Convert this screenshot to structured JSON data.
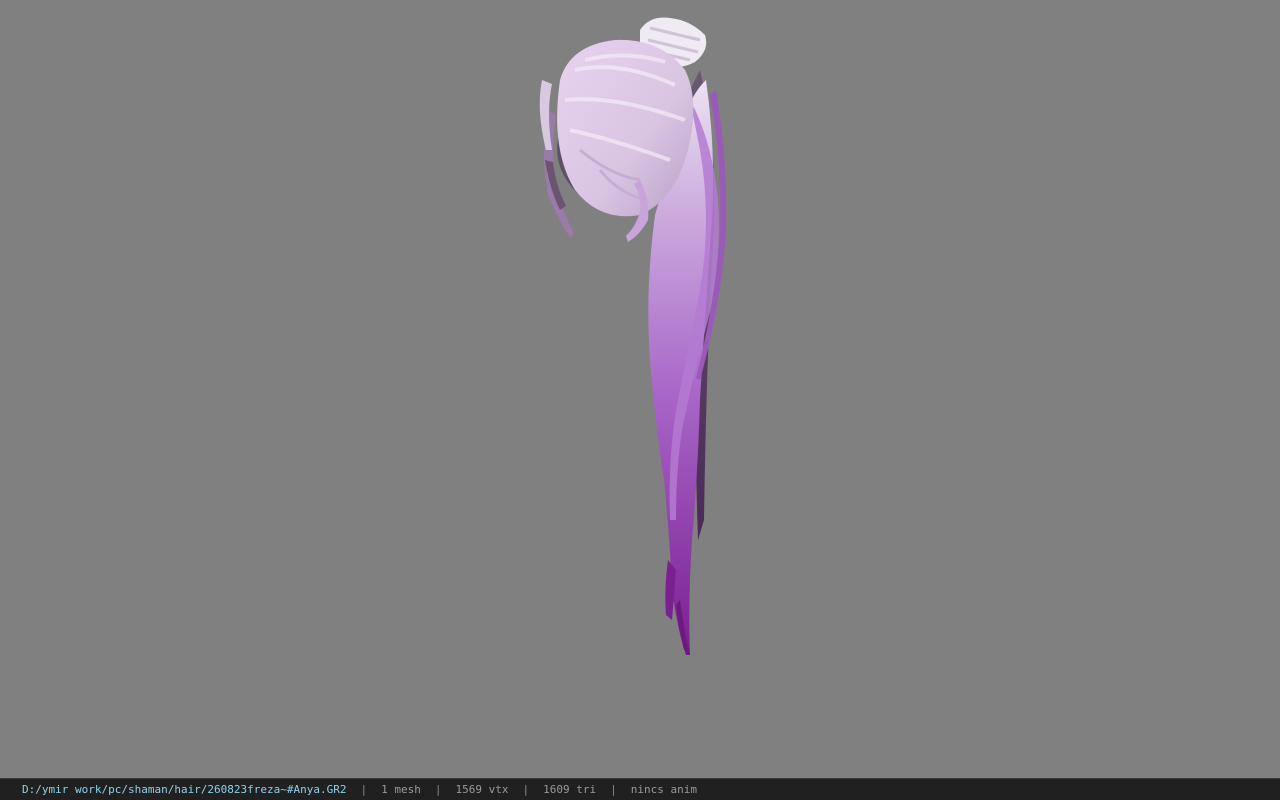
{
  "viewport": {
    "background_color": "#808080",
    "model": {
      "name": "hair-ponytail-mesh",
      "colors": {
        "top": "#e8ddee",
        "mid": "#b07ad0",
        "bottom": "#7a2a8e",
        "shadow": "#5a4a62"
      }
    }
  },
  "statusbar": {
    "file_path": "D:/ymir work/pc/shaman/hair/260823freza~#Anya.GR2",
    "mesh_count": "1 mesh",
    "vertex_count": "1569 vtx",
    "triangle_count": "1609 tri",
    "anim_status": "nincs anim",
    "separator": "|",
    "path_color": "#8fd0e8",
    "text_color": "#9a9a9a"
  }
}
